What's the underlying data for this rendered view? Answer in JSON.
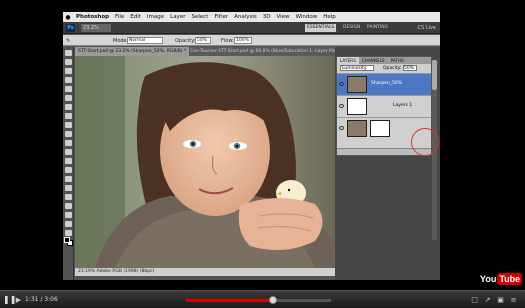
{
  "photoshop": {
    "menu": [
      "Photoshop",
      "File",
      "Edit",
      "Image",
      "Layer",
      "Select",
      "Filter",
      "Analysis",
      "3D",
      "View",
      "Window",
      "Help"
    ],
    "app_badge": "Ps",
    "zoom": "23.2%",
    "workspaces": [
      "ESSENTIALS",
      "DESIGN",
      "PAINTING"
    ],
    "cs_live": "CS Live",
    "options": {
      "mode_label": "Mode:",
      "mode_value": "Normal",
      "opacity_label": "Opacity:",
      "opacity_value": "50%",
      "flow_label": "Flow:",
      "flow_value": "100%"
    },
    "tabs": [
      "STT-Start.psd @ 23.2% (Sharpen_50%, RGB/8) *",
      "Con-Tourner-STT-Start.psd @ 66.8% (Blue/Saturation 1, Layer Mask/8)"
    ],
    "status_text": "23.19%    Adobe RGB (1998) (8bpc)",
    "layers_panel": {
      "tabs": [
        "LAYERS",
        "CHANNELS",
        "PATHS"
      ],
      "blend_mode": "Luminosity",
      "opacity_label": "Opacity:",
      "opacity_value": "50%",
      "layers": [
        {
          "name": "Sharpen_50%",
          "selected": true
        },
        {
          "name": "Layers 1",
          "selected": false
        },
        {
          "name": "",
          "selected": false
        }
      ]
    }
  },
  "youtube": {
    "logo_you": "You",
    "logo_tube": "Tube",
    "play_icon": "pause-icon",
    "timecode": "1:31 / 3:06",
    "progress_fraction": 0.6,
    "buffered_fraction": 1.0
  }
}
